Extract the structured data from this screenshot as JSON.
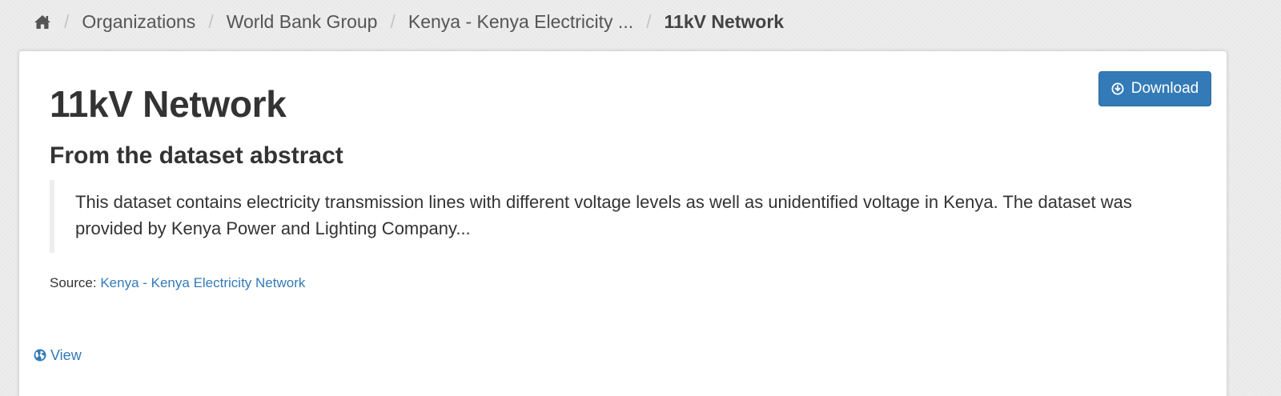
{
  "breadcrumb": {
    "home_icon": "home-icon",
    "items": [
      {
        "label": "Organizations"
      },
      {
        "label": "World Bank Group"
      },
      {
        "label": "Kenya - Kenya Electricity ..."
      }
    ],
    "current": "11kV Network",
    "separator": "/"
  },
  "resource": {
    "title": "11kV Network",
    "download_label": "Download",
    "download_icon": "download-circle-icon",
    "abstract_heading": "From the dataset abstract",
    "abstract_text": "This dataset contains electricity transmission lines with different voltage levels as well as unidentified voltage in Kenya. The dataset was provided by Kenya Power and Lighting Company...",
    "source_label": "Source:",
    "source_link": "Kenya - Kenya Electricity Network",
    "view_label": "View",
    "view_icon": "globe-icon"
  },
  "colors": {
    "accent": "#337ab7",
    "background": "#ececec",
    "text": "#333333"
  }
}
